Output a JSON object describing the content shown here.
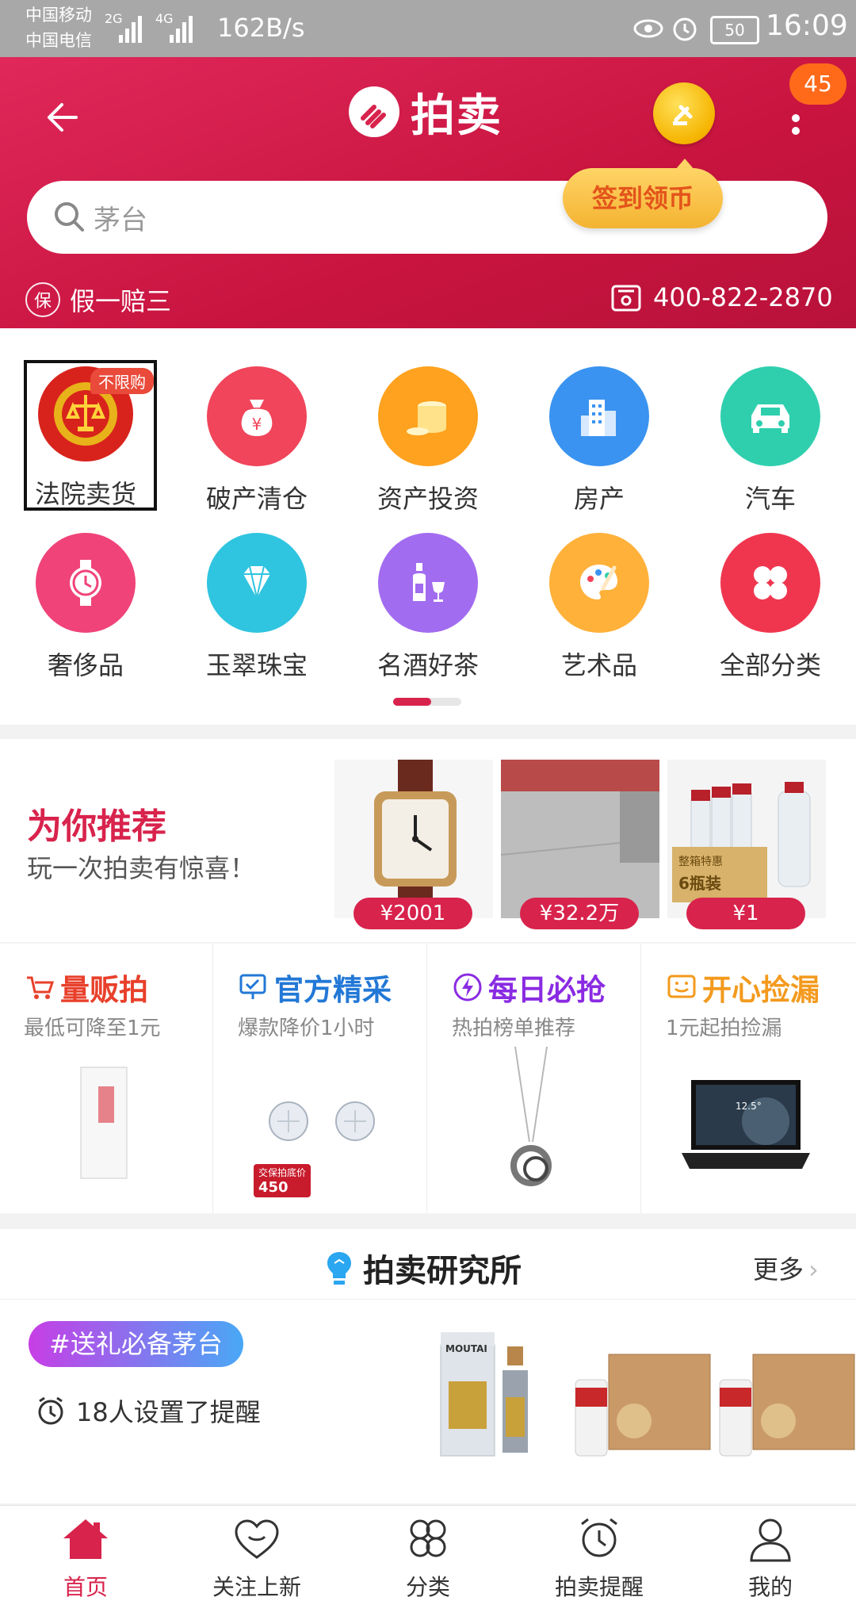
{
  "status_bar": {
    "carrier1": "中国移动",
    "carrier2": "中国电信",
    "net1": "2G",
    "net2": "4G",
    "speed": "162B/s",
    "battery": "50",
    "time": "16:09"
  },
  "header": {
    "logo_text": "拍卖",
    "badge_count": "45",
    "search_placeholder": "茅台",
    "signin_label": "签到领币",
    "guarantee": "假一赔三",
    "guarantee_icon_text": "保",
    "phone": "400-822-2870"
  },
  "categories": [
    {
      "label": "法院卖货",
      "badge": "不限购",
      "icon": "court-emblem-icon",
      "color": "#d8231c"
    },
    {
      "label": "破产清仓",
      "icon": "money-bag-icon",
      "color": "#f0455a"
    },
    {
      "label": "资产投资",
      "icon": "coins-icon",
      "color": "#ffa21f"
    },
    {
      "label": "房产",
      "icon": "building-icon",
      "color": "#3a93f0"
    },
    {
      "label": "汽车",
      "icon": "car-icon",
      "color": "#2fcfae"
    },
    {
      "label": "奢侈品",
      "icon": "watch-icon",
      "color": "#f0437a"
    },
    {
      "label": "玉翠珠宝",
      "icon": "diamond-icon",
      "color": "#2fc4e0"
    },
    {
      "label": "名酒好茶",
      "icon": "wine-icon",
      "color": "#a26cf0"
    },
    {
      "label": "艺术品",
      "icon": "palette-icon",
      "color": "#ffb13a"
    },
    {
      "label": "全部分类",
      "icon": "clover-icon",
      "color": "#f0364f"
    }
  ],
  "recommend": {
    "title": "为你推荐",
    "subtitle": "玩一次拍卖有惊喜！",
    "items": [
      {
        "price": "¥2001"
      },
      {
        "price": "¥32.2万"
      },
      {
        "price": "¥1",
        "box_text1": "整箱特惠",
        "box_text2": "6瓶装"
      }
    ]
  },
  "promos": [
    {
      "title": "量贩拍",
      "subtitle": "最低可降至1元",
      "color": "#e8402b"
    },
    {
      "title": "官方精采",
      "subtitle": "爆款降价1小时",
      "color": "#2278d6",
      "tag_top": "交保拍底价",
      "tag_price": "450"
    },
    {
      "title": "每日必抢",
      "subtitle": "热拍榜单推荐",
      "color": "#8a2be2"
    },
    {
      "title": "开心捡漏",
      "subtitle": "1元起拍捡漏",
      "color": "#f39a1e",
      "screen_text": "12.5°"
    }
  ],
  "lab": {
    "title": "拍卖研究所",
    "more": "更多",
    "tag": "#送礼必备茅台",
    "reminder": "18人设置了提醒",
    "moutai_label": "MOUTAI"
  },
  "tabs": [
    {
      "label": "首页",
      "icon": "home-icon",
      "active": true
    },
    {
      "label": "关注上新",
      "icon": "heart-icon",
      "active": false
    },
    {
      "label": "分类",
      "icon": "category-icon",
      "active": false
    },
    {
      "label": "拍卖提醒",
      "icon": "alarm-icon",
      "active": false
    },
    {
      "label": "我的",
      "icon": "user-icon",
      "active": false
    }
  ],
  "colors": {
    "brand": "#d8234c",
    "active_tab": "#d8234c"
  }
}
